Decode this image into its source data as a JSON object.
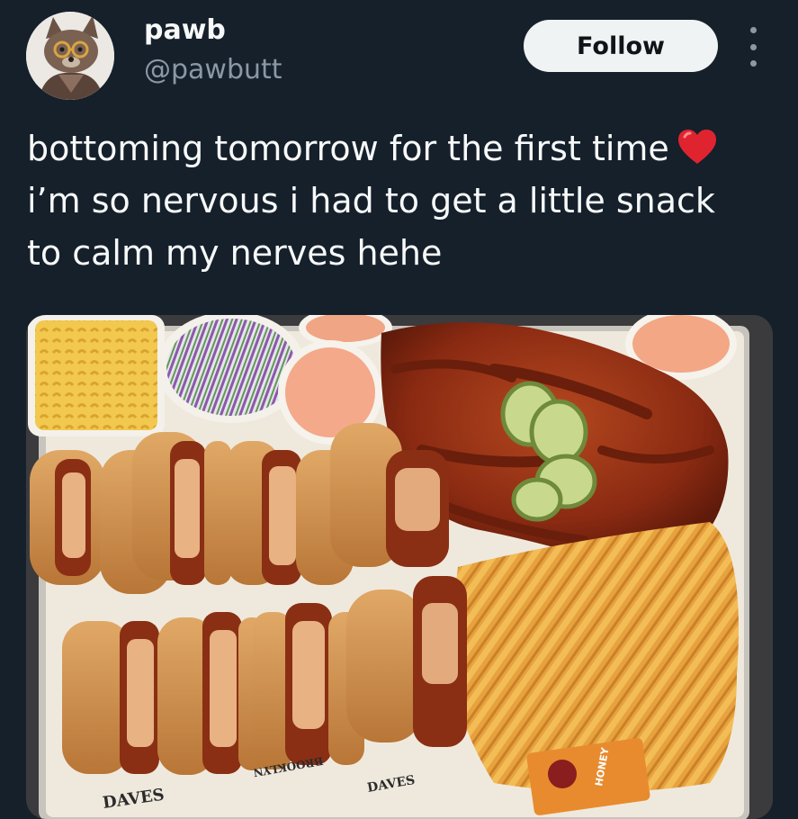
{
  "tweet": {
    "display_name": "pawb",
    "handle": "@pawbutt",
    "follow_label": "Follow",
    "text": "bottoming tomorrow for the first time",
    "text_line2": "i’m so nervous i had to get a little snack",
    "text_line3": "to calm my nerves hehe",
    "heart_icon": "red-heart-emoji",
    "more_icon": "more-horizontal-icon"
  },
  "media": {
    "tray_text_1": "DAVES",
    "tray_text_2": "DAVES",
    "tray_text_3": "BROOKLYN",
    "honey_label": "HONEY"
  },
  "colors": {
    "background": "#15202b",
    "text_primary": "#f7f9f9",
    "text_secondary": "#8b98a5",
    "button_bg": "#eff3f4",
    "button_text": "#0f1419",
    "heart": "#e0242f"
  }
}
